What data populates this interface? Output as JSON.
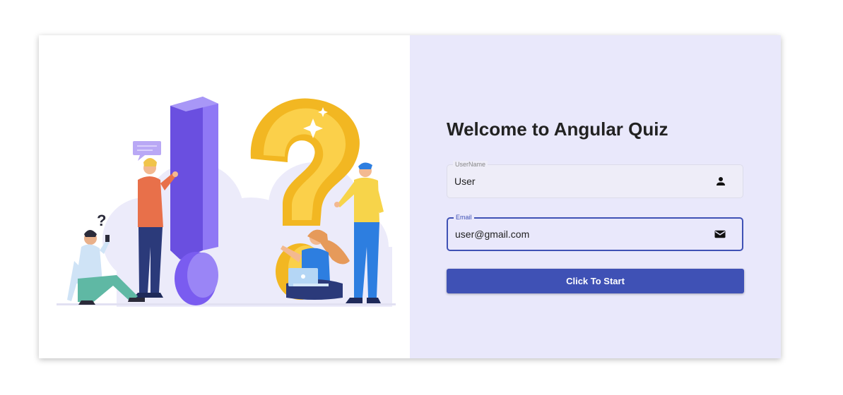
{
  "page": {
    "title": "Welcome to Angular Quiz"
  },
  "form": {
    "username": {
      "label": "UserName",
      "value": "User",
      "icon": "person-icon"
    },
    "email": {
      "label": "Email",
      "value": "user@gmail.com",
      "icon": "mail-icon",
      "focused": true
    },
    "submit_label": "Click To Start"
  },
  "colors": {
    "right_panel_bg": "#e9e8fb",
    "primary": "#3f51b5",
    "exclamation": "#7a5cf0",
    "question": "#f7c432"
  },
  "illustration": {
    "name": "quiz-people-illustration"
  }
}
